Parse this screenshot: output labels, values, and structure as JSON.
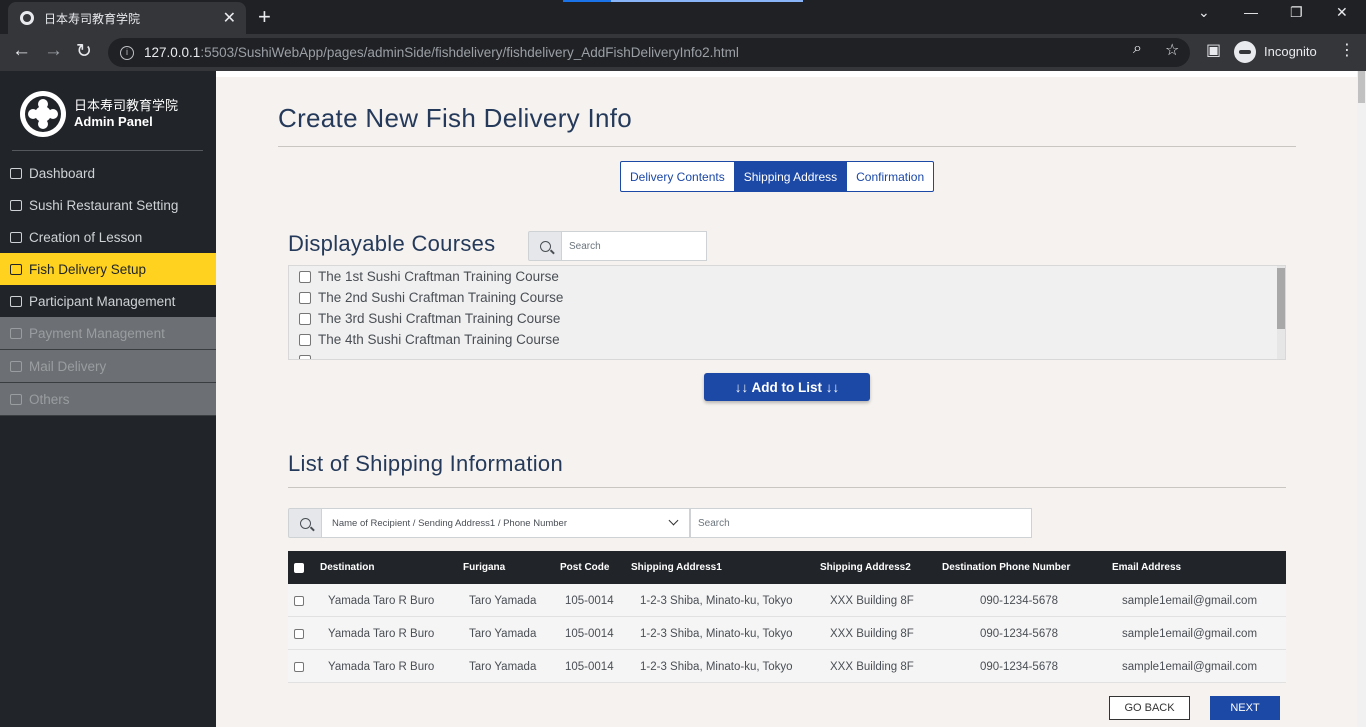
{
  "browser": {
    "tab_title": "日本寿司教育学院",
    "url_host": "127.0.0.1",
    "url_rest": ":5503/SushiWebApp/pages/adminSide/fishdelivery/fishdelivery_AddFishDeliveryInfo2.html",
    "profile_label": "Incognito"
  },
  "sidebar": {
    "brand_line1": "日本寿司教育学院",
    "brand_line2": "Admin Panel",
    "items": [
      {
        "label": "Dashboard",
        "icon": "users-icon",
        "state": "normal"
      },
      {
        "label": "Sushi Restaurant Setting",
        "icon": "document-icon",
        "state": "normal"
      },
      {
        "label": "Creation of Lesson",
        "icon": "document-icon",
        "state": "normal"
      },
      {
        "label": "Fish Delivery Setup",
        "icon": "document-icon",
        "state": "active"
      },
      {
        "label": "Participant Management",
        "icon": "card-icon",
        "state": "normal"
      },
      {
        "label": "Payment Management",
        "icon": "warning-icon",
        "state": "disabled"
      },
      {
        "label": "Mail Delivery",
        "icon": "chat-icon",
        "state": "disabled"
      },
      {
        "label": "Others",
        "icon": "messenger-icon",
        "state": "disabled"
      }
    ]
  },
  "main": {
    "title": "Create New Fish Delivery Info",
    "steps": [
      "Delivery Contents",
      "Shipping Address",
      "Confirmation"
    ],
    "active_step": 1,
    "courses_title": "Displayable Courses",
    "courses_search_placeholder": "Search",
    "courses": [
      "The 1st Sushi Craftman Training Course",
      "The 2nd Sushi Craftman Training Course",
      "The 3rd Sushi Craftman Training Course",
      "The 4th Sushi Craftman Training Course"
    ],
    "add_button": "↓↓ Add to List ↓↓",
    "shipping_title": "List of Shipping Information",
    "filter_selected": "Name of Recipient / Sending Address1 / Phone Number",
    "shipping_search_placeholder": "Search",
    "columns": [
      "Destination",
      "Furigana",
      "Post Code",
      "Shipping Address1",
      "Shipping Address2",
      "Destination Phone Number",
      "Email Address"
    ],
    "rows": [
      [
        "Yamada Taro R Buro",
        "Taro Yamada",
        "105-0014",
        "1-2-3 Shiba, Minato-ku, Tokyo",
        "XXX Building 8F",
        "090-1234-5678",
        "sample1email@gmail.com"
      ],
      [
        "Yamada Taro R Buro",
        "Taro Yamada",
        "105-0014",
        "1-2-3 Shiba, Minato-ku, Tokyo",
        "XXX Building 8F",
        "090-1234-5678",
        "sample1email@gmail.com"
      ],
      [
        "Yamada Taro R Buro",
        "Taro Yamada",
        "105-0014",
        "1-2-3 Shiba, Minato-ku, Tokyo",
        "XXX Building 8F",
        "090-1234-5678",
        "sample1email@gmail.com"
      ]
    ],
    "back_button": "GO BACK",
    "next_button": "NEXT"
  },
  "colors": {
    "accent": "#1c48a6",
    "sidebar_bg": "#212529",
    "active_menu": "#ffd21f",
    "page_bg": "#f5f2ef"
  }
}
